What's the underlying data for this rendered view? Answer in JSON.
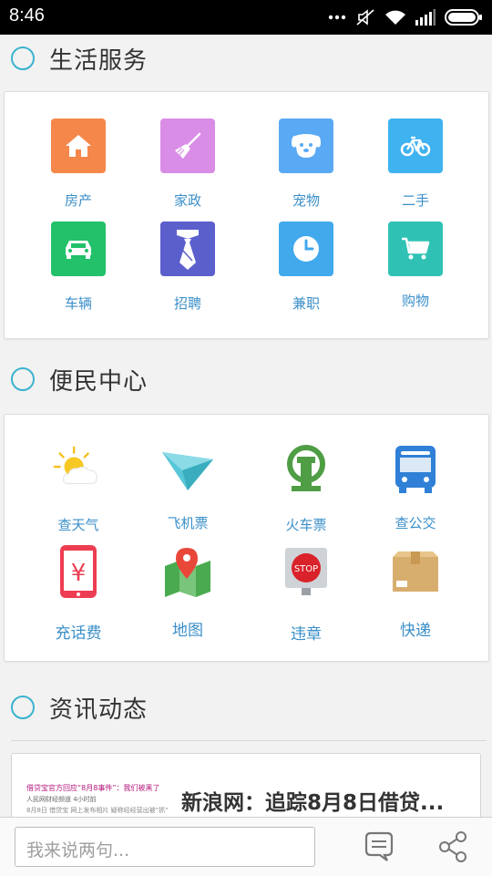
{
  "status_bar": {
    "time": "8:46"
  },
  "sections": {
    "life": {
      "title": "生活服务",
      "items": [
        {
          "label": "房产",
          "icon": "house-icon",
          "color": "#f5874b"
        },
        {
          "label": "家政",
          "icon": "broom-icon",
          "color": "#d98de6"
        },
        {
          "label": "宠物",
          "icon": "dog-icon",
          "color": "#5aa9f4"
        },
        {
          "label": "二手",
          "icon": "bicycle-icon",
          "color": "#3fb2f0"
        },
        {
          "label": "车辆",
          "icon": "car-icon",
          "color": "#22c16a"
        },
        {
          "label": "招聘",
          "icon": "tie-icon",
          "color": "#5b5fcc"
        },
        {
          "label": "兼职",
          "icon": "clock-icon",
          "color": "#41a9ec"
        },
        {
          "label": "购物",
          "icon": "cart-icon",
          "color": "#2fc2b4"
        }
      ]
    },
    "convenience": {
      "title": "便民中心",
      "items": [
        {
          "label": "查天气",
          "icon": "weather-icon"
        },
        {
          "label": "飞机票",
          "icon": "paper-plane-icon"
        },
        {
          "label": "火车票",
          "icon": "railway-icon"
        },
        {
          "label": "查公交",
          "icon": "bus-icon"
        },
        {
          "label": "充话费",
          "icon": "phone-recharge-icon"
        },
        {
          "label": "地图",
          "icon": "map-icon"
        },
        {
          "label": "违章",
          "icon": "stop-sign-icon"
        },
        {
          "label": "快递",
          "icon": "package-icon"
        }
      ]
    },
    "news": {
      "title": "资讯动态",
      "items": [
        {
          "thumb_line1": "借贷宝官方回应“8月8事件”：我们被黑了",
          "thumb_line2": "人民网财经频道  4小时前",
          "thumb_line3": "8月8日 借贷宝 网上发布相片 疑称经经营出被“抓”",
          "title": "新浪网：追踪8月8日借贷..."
        }
      ]
    }
  },
  "bottom_bar": {
    "input_placeholder": "我来说两句..."
  },
  "colors": {
    "accent": "#3bb2cf",
    "label": "#3b8fc9"
  }
}
